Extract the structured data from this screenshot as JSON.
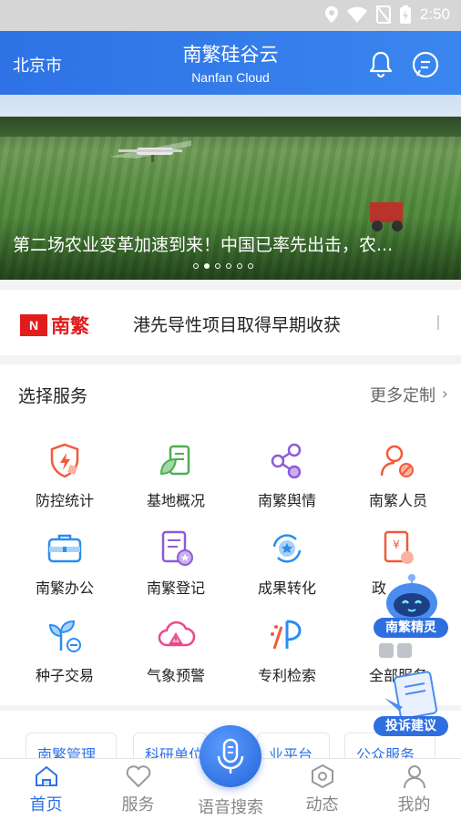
{
  "status_bar": {
    "time": "2:50"
  },
  "header": {
    "city": "北京市",
    "title": "南繁硅谷云",
    "subtitle": "Nanfan Cloud"
  },
  "banner": {
    "caption": "第二场农业变革加速到来！中国已率先出击，农...",
    "page_count": 6,
    "active_page": 1
  },
  "news": {
    "logo_n": "N",
    "logo_brand": "南繁",
    "headline": "港先导性项目取得早期收获"
  },
  "services": {
    "title": "选择服务",
    "more_label": "更多定制",
    "items": [
      {
        "label": "防控统计",
        "icon": "shield-lightning-icon"
      },
      {
        "label": "基地概况",
        "icon": "leaf-document-icon"
      },
      {
        "label": "南繁舆情",
        "icon": "share-nodes-icon"
      },
      {
        "label": "南繁人员",
        "icon": "person-block-icon"
      },
      {
        "label": "南繁办公",
        "icon": "briefcase-icon"
      },
      {
        "label": "南繁登记",
        "icon": "register-form-icon"
      },
      {
        "label": "成果转化",
        "icon": "star-cycle-icon"
      },
      {
        "label": "政",
        "icon": "yuan-document-icon"
      },
      {
        "label": "种子交易",
        "icon": "seedling-icon"
      },
      {
        "label": "气象预警",
        "icon": "cloud-warning-icon"
      },
      {
        "label": "专利检索",
        "icon": "patent-icon"
      },
      {
        "label": "全部服务",
        "icon": "all-services-icon"
      }
    ]
  },
  "partial_chips": [
    "南繁管理",
    "科研单位",
    "业平台",
    "公众服务"
  ],
  "assistant": {
    "label": "南繁精灵"
  },
  "complaint": {
    "label": "投诉建议"
  },
  "tabbar": {
    "tabs": [
      {
        "label": "首页",
        "icon": "home-icon",
        "active": true
      },
      {
        "label": "服务",
        "icon": "heart-icon",
        "active": false
      },
      {
        "label": "语音搜索",
        "icon": "microphone-icon",
        "active": false
      },
      {
        "label": "动态",
        "icon": "hexagon-icon",
        "active": false
      },
      {
        "label": "我的",
        "icon": "user-icon",
        "active": false
      }
    ]
  },
  "colors": {
    "primary": "#2e72e6",
    "news_red": "#e21b1b",
    "text": "#222222",
    "muted": "#888888"
  }
}
